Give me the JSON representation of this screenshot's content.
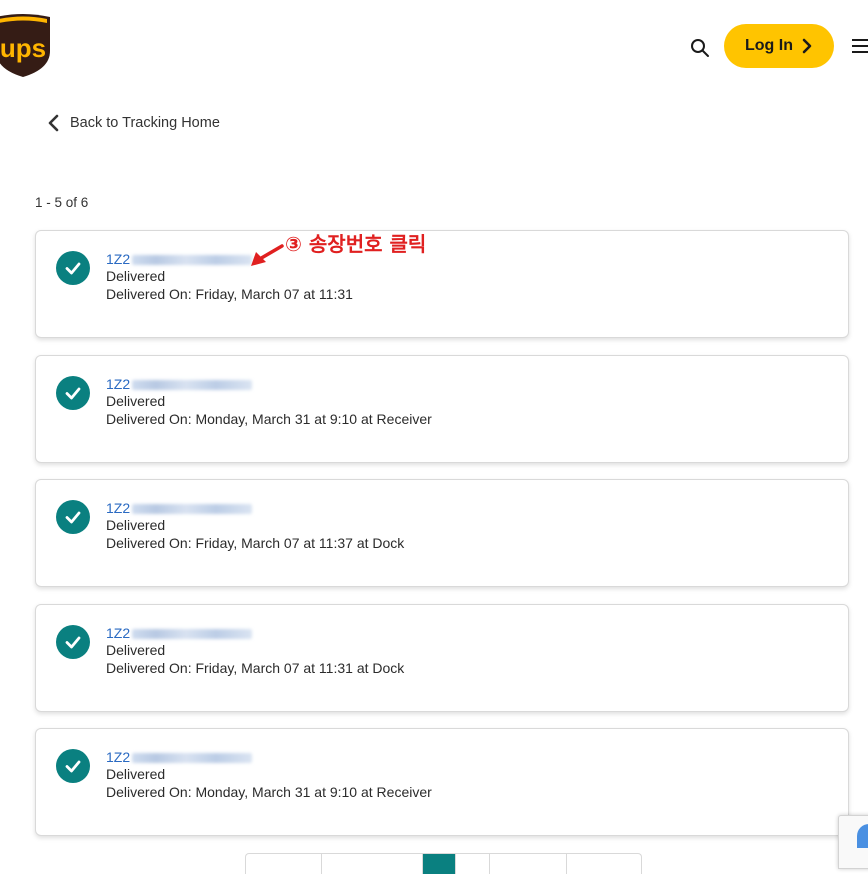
{
  "header": {
    "logo_text": "ups",
    "login_label": "Log In",
    "search_icon": "search-icon",
    "menu_icon": "menu-icon"
  },
  "back_link": {
    "label": "Back to Tracking Home"
  },
  "results_count": "1 - 5 of 6",
  "annotation": {
    "text": "③ 송장번호 클릭",
    "color": "#e02020"
  },
  "shipments": [
    {
      "tracking_prefix": "1Z2",
      "status": "Delivered",
      "detail": "Delivered On: Friday, March 07 at 11:31"
    },
    {
      "tracking_prefix": "1Z2",
      "status": "Delivered",
      "detail": "Delivered On: Monday, March 31 at 9:10 at Receiver"
    },
    {
      "tracking_prefix": "1Z2",
      "status": "Delivered",
      "detail": "Delivered On: Friday, March 07 at 11:37 at Dock"
    },
    {
      "tracking_prefix": "1Z2",
      "status": "Delivered",
      "detail": "Delivered On: Friday, March 07 at 11:31 at Dock"
    },
    {
      "tracking_prefix": "1Z2",
      "status": "Delivered",
      "detail": "Delivered On: Monday, March 31 at 9:10 at Receiver"
    }
  ],
  "colors": {
    "brand_brown": "#351c15",
    "brand_gold": "#ffb500",
    "login_yellow": "#ffc400",
    "check_teal": "#0a8080",
    "link_blue": "#2a6ac2"
  }
}
